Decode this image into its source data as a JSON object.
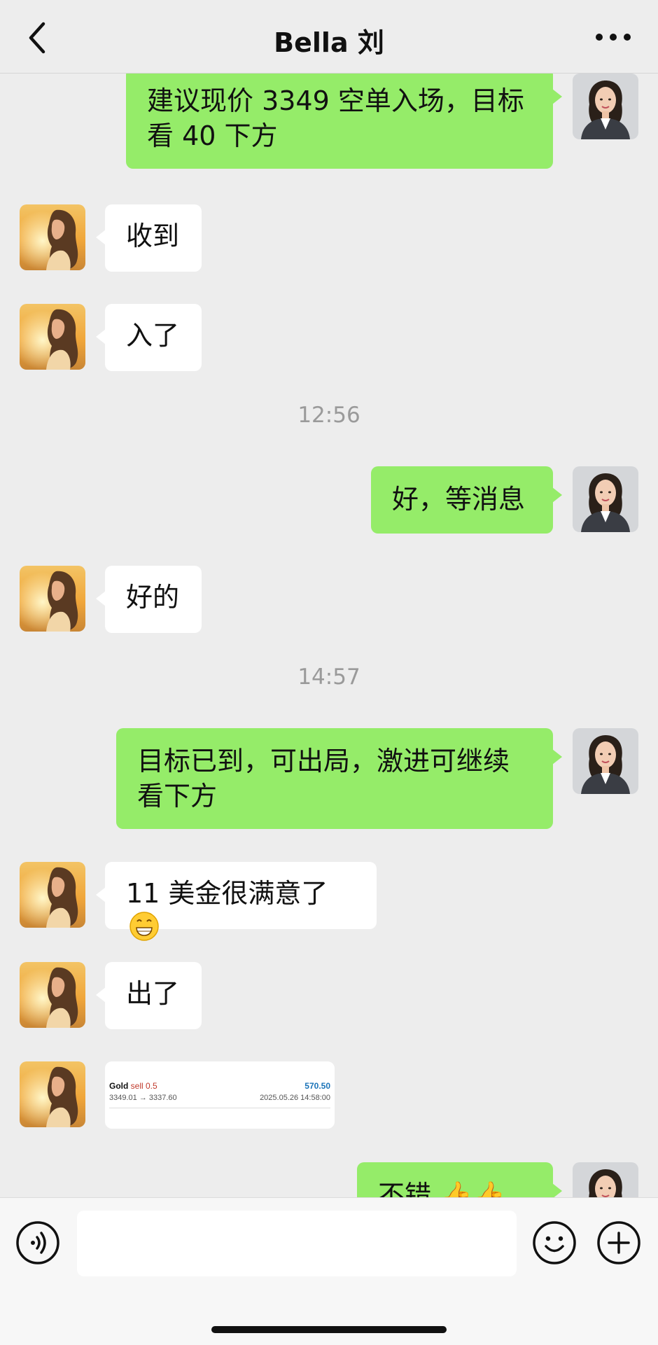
{
  "header": {
    "title": "Bella 刘"
  },
  "messages": [
    {
      "from": "self",
      "text": "建议现价 3349 空单入场，目标看 40 下方"
    },
    {
      "from": "other",
      "text": "收到"
    },
    {
      "from": "other",
      "text": "入了"
    },
    {
      "type": "time",
      "text": "12:56"
    },
    {
      "from": "self",
      "text": "好，等消息"
    },
    {
      "from": "other",
      "text": "好的"
    },
    {
      "type": "time",
      "text": "14:57"
    },
    {
      "from": "self",
      "text": "目标已到，可出局，激进可继续看下方"
    },
    {
      "from": "other",
      "text": "11 美金很满意了",
      "emoji": "grinning-face"
    },
    {
      "from": "other",
      "text": "出了"
    },
    {
      "from": "other",
      "type": "image",
      "card": {
        "symbol": "Gold",
        "side": "sell 0.5",
        "profit": "570.50",
        "prices": "3349.01 → 3337.60",
        "datetime": "2025.05.26 14:58:00"
      }
    },
    {
      "from": "self",
      "text": "不错"
    }
  ],
  "input": {
    "value": "",
    "placeholder": ""
  },
  "colors": {
    "sent_bubble": "#95ec69",
    "recv_bubble": "#ffffff",
    "background": "#ededed"
  },
  "icons": {
    "back": "chevron-left-icon",
    "more": "more-dots-icon",
    "voice": "voice-icon",
    "emoji": "emoji-icon",
    "plus": "plus-icon"
  }
}
